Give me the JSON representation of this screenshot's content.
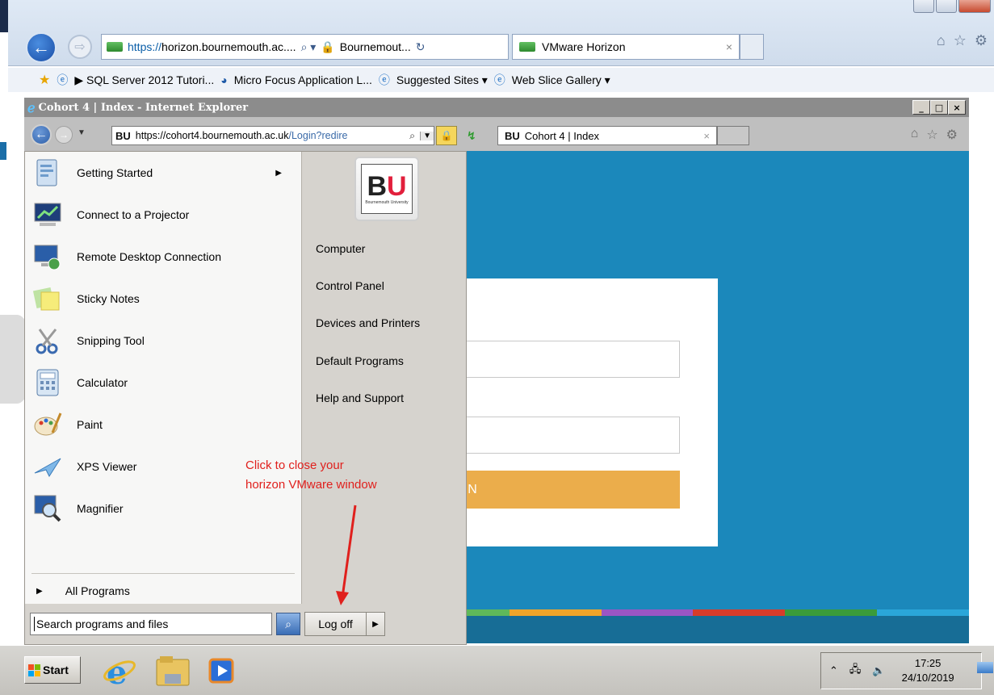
{
  "outer_browser": {
    "address_url_scheme": "https://",
    "address_url_host": "horizon.bournemouth.ac....",
    "address_search_glyph": "⌕ ▾",
    "address_site_name": "Bournemout...",
    "address_refresh_glyph": "↻",
    "tab_title": "VMware Horizon",
    "tab_close": "×",
    "favorites": [
      {
        "label": "▶ SQL Server 2012 Tutori..."
      },
      {
        "label": "Micro Focus Application L..."
      },
      {
        "label": "Suggested Sites ▾"
      },
      {
        "label": "Web Slice Gallery ▾"
      }
    ]
  },
  "inner_window": {
    "title": "Cohort 4 | Index - Internet Explorer",
    "controls": [
      "_",
      "□",
      "×"
    ],
    "address_bu": "BU",
    "address_url_scheme": "https://",
    "address_url_host": "cohort4.bournemouth.ac.uk",
    "address_url_path": "/Login?redire",
    "address_search_glyph": "⌕",
    "tab_bu": "BU",
    "tab_title": "Cohort 4 | Index",
    "tab_close": "×"
  },
  "login_page": {
    "login_button": "LOGIN",
    "stripe_colors": [
      "#5fb85a",
      "#f0a429",
      "#9b55c4",
      "#d83c2a",
      "#3a9b3a",
      "#2aa6d9"
    ]
  },
  "start_menu": {
    "programs": [
      {
        "label": "Getting Started",
        "icon": "getting-started-icon",
        "has_submenu": true
      },
      {
        "label": "Connect to a Projector",
        "icon": "projector-icon"
      },
      {
        "label": "Remote Desktop Connection",
        "icon": "remote-desktop-icon"
      },
      {
        "label": "Sticky Notes",
        "icon": "sticky-notes-icon"
      },
      {
        "label": "Snipping Tool",
        "icon": "snipping-tool-icon"
      },
      {
        "label": "Calculator",
        "icon": "calculator-icon"
      },
      {
        "label": "Paint",
        "icon": "paint-icon"
      },
      {
        "label": "XPS Viewer",
        "icon": "xps-viewer-icon"
      },
      {
        "label": "Magnifier",
        "icon": "magnifier-icon"
      }
    ],
    "submenu_arrow": "▶",
    "all_programs": "All Programs",
    "all_programs_arrow": "▶",
    "search_placeholder": "Search programs and files",
    "right_items": [
      {
        "label": "Computer"
      },
      {
        "label": "Control Panel"
      },
      {
        "label": "Devices and Printers"
      },
      {
        "label": "Default Programs"
      },
      {
        "label": "Help and Support"
      }
    ],
    "bu_logo_b": "B",
    "bu_logo_u": "U",
    "bu_logo_sub": "Bournemouth University",
    "log_off": "Log off",
    "log_off_arrow": "▶"
  },
  "annotation": {
    "line1": "Click to close your",
    "line2": "horizon VMware window",
    "color": "#e0201d"
  },
  "taskbar": {
    "start_label": "Start",
    "tray_expand": "⌃",
    "time": "17:25",
    "date": "24/10/2019"
  }
}
